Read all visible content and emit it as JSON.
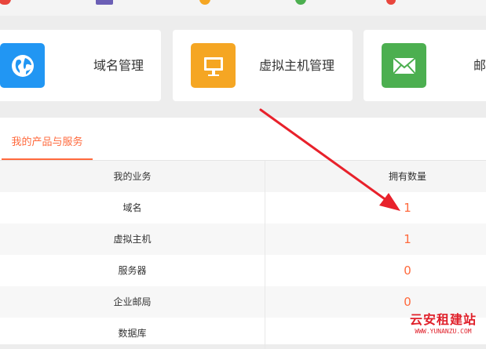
{
  "top_icons": [
    {
      "name": "red-partial-icon",
      "color": "#e8453c"
    },
    {
      "name": "purple-partial-icon",
      "color": "#6b5fb5"
    },
    {
      "name": "orange-partial-icon",
      "color": "#f5a623"
    },
    {
      "name": "green-partial-icon",
      "color": "#4caf50"
    },
    {
      "name": "red-partial-icon-2",
      "color": "#e8453c"
    }
  ],
  "cards": [
    {
      "label": "域名管理",
      "icon": "globe-icon",
      "color": "#2196f3"
    },
    {
      "label": "虚拟主机管理",
      "icon": "monitor-icon",
      "color": "#f5a623"
    },
    {
      "label": "邮",
      "icon": "envelope-icon",
      "color": "#4caf50"
    }
  ],
  "panel": {
    "tab_label": "我的产品与服务",
    "table": {
      "headers": [
        "我的业务",
        "拥有数量"
      ],
      "rows": [
        {
          "service": "域名",
          "count": "1"
        },
        {
          "service": "虚拟主机",
          "count": "1"
        },
        {
          "service": "服务器",
          "count": "0"
        },
        {
          "service": "企业邮局",
          "count": "0"
        },
        {
          "service": "数据库",
          "count": ""
        }
      ]
    }
  },
  "watermark": {
    "title": "云安租建站",
    "url": "WWW.YUNANZU.COM"
  },
  "colors": {
    "accent": "#ff6a3d",
    "arrow": "#e8212b"
  }
}
